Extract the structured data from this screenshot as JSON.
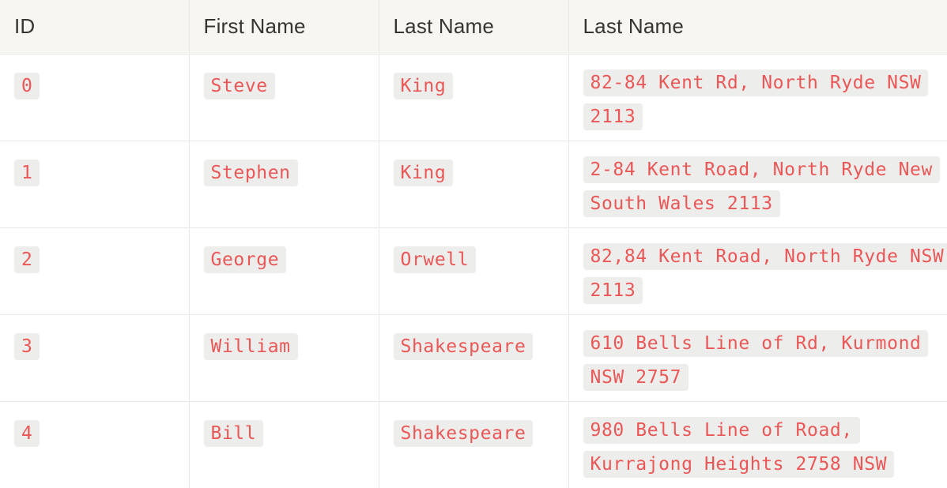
{
  "table": {
    "headers": [
      "ID",
      "First Name",
      "Last Name",
      "Last Name"
    ],
    "rows": [
      {
        "id": "0",
        "first": "Steve",
        "last": "King",
        "address": "82-84 Kent Rd, North Ryde NSW 2113"
      },
      {
        "id": "1",
        "first": "Stephen",
        "last": "King",
        "address": "2-84 Kent Road, North Ryde New South Wales 2113"
      },
      {
        "id": "2",
        "first": "George",
        "last": "Orwell",
        "address": "82,84 Kent Road, North Ryde NSW 2113"
      },
      {
        "id": "3",
        "first": "William",
        "last": "Shakespeare",
        "address": "610 Bells Line of Rd, Kurmond NSW 2757"
      },
      {
        "id": "4",
        "first": "Bill",
        "last": "Shakespeare",
        "address": "980 Bells Line of Road, Kurrajong Heights 2758 NSW"
      }
    ]
  },
  "colors": {
    "code_text": "#eb5757",
    "header_bg": "#f7f6f3",
    "border": "#e9e9e7"
  }
}
